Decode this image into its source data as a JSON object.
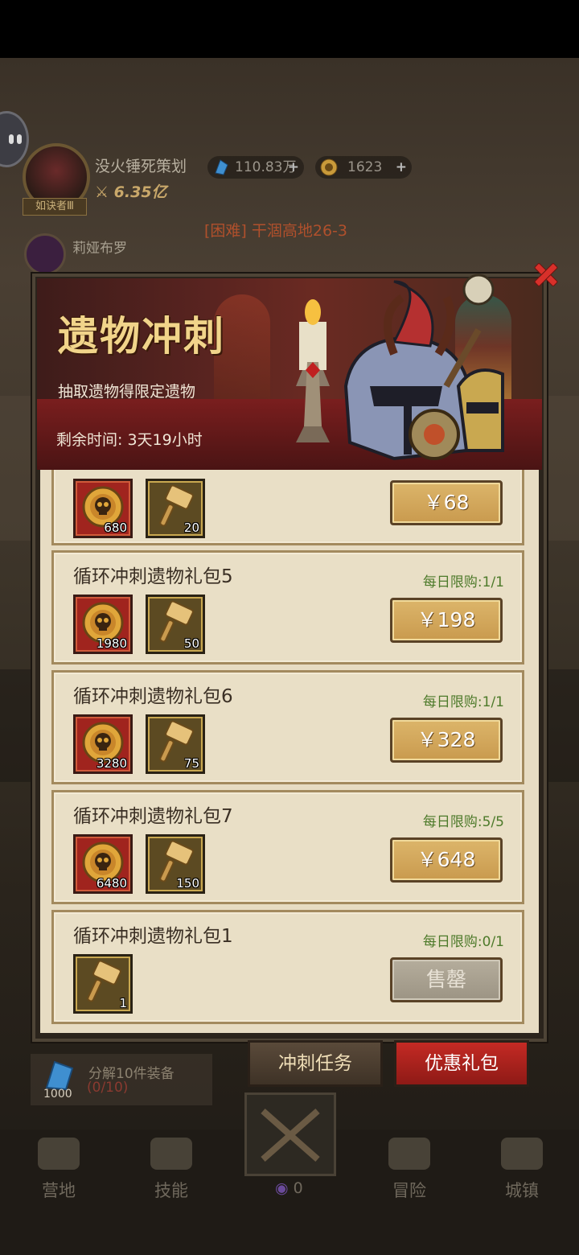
{
  "player": {
    "name": "没火锤死策划",
    "title_badge": "如诀者Ⅲ",
    "power": "6.35亿"
  },
  "currencies": [
    {
      "icon": "crystal-icon",
      "value": "110.83万",
      "plus": "+"
    },
    {
      "icon": "coin-icon",
      "value": "1623",
      "plus": "+"
    }
  ],
  "companion": {
    "name": "莉娅布罗"
  },
  "stage": "[困难] 干涸高地26-3",
  "event": {
    "title": "遗物冲刺",
    "subtitle": "抽取遗物得限定遗物",
    "time_label": "剩余时间: 3天19小时"
  },
  "packs": [
    {
      "name": "",
      "limit": "",
      "items": [
        {
          "type": "skull-coin",
          "qty": "680"
        },
        {
          "type": "hammer",
          "qty": "20"
        }
      ],
      "price": "￥68",
      "sold_out": false
    },
    {
      "name": "循环冲刺遗物礼包5",
      "limit": "每日限购:1/1",
      "items": [
        {
          "type": "skull-coin",
          "qty": "1980"
        },
        {
          "type": "hammer",
          "qty": "50"
        }
      ],
      "price": "￥198",
      "sold_out": false
    },
    {
      "name": "循环冲刺遗物礼包6",
      "limit": "每日限购:1/1",
      "items": [
        {
          "type": "skull-coin",
          "qty": "3280"
        },
        {
          "type": "hammer",
          "qty": "75"
        }
      ],
      "price": "￥328",
      "sold_out": false
    },
    {
      "name": "循环冲刺遗物礼包7",
      "limit": "每日限购:5/5",
      "items": [
        {
          "type": "skull-coin",
          "qty": "6480"
        },
        {
          "type": "hammer",
          "qty": "150"
        }
      ],
      "price": "￥648",
      "sold_out": false
    },
    {
      "name": "循环冲刺遗物礼包1",
      "limit": "每日限购:0/1",
      "items": [
        {
          "type": "hammer",
          "qty": "1"
        }
      ],
      "price": "售罄",
      "sold_out": true
    }
  ],
  "tabs": {
    "task": "冲刺任务",
    "gift": "优惠礼包"
  },
  "decompose": {
    "text": "分解10件装备",
    "progress": "(0/10)",
    "count": "1000"
  },
  "nav": [
    {
      "label": "营地",
      "icon": "tent-icon"
    },
    {
      "label": "技能",
      "icon": "skill-icon"
    },
    {
      "label": "冒险",
      "icon": "map-icon"
    },
    {
      "label": "城镇",
      "icon": "castle-icon"
    }
  ],
  "gem_count": "0",
  "colors": {
    "limit_green": "#4d7a2a",
    "gift_red": "#c42a24",
    "price_gold": "#dcb56a",
    "title_gold": "#f1d48a"
  }
}
